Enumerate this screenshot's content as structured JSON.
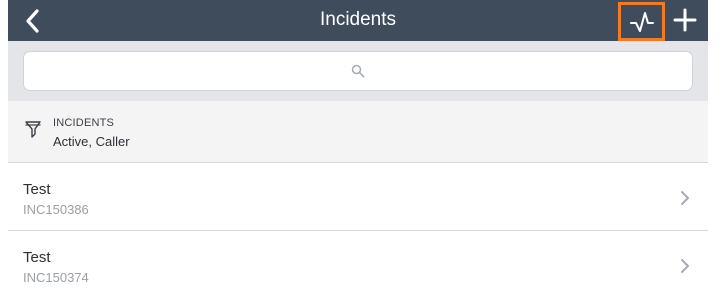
{
  "header": {
    "title": "Incidents",
    "back_icon": "chevron-left-icon",
    "activity_icon": "activity-pulse-icon",
    "add_icon": "plus-icon",
    "background_color": "#3e4c5c",
    "highlight_color": "#f07a26"
  },
  "search": {
    "placeholder": "",
    "icon": "search-icon"
  },
  "filter": {
    "icon": "filter-funnel-icon",
    "title": "INCIDENTS",
    "subtitle": "Active, Caller"
  },
  "incidents": [
    {
      "title": "Test",
      "number": "INC150386"
    },
    {
      "title": "Test",
      "number": "INC150374"
    }
  ]
}
